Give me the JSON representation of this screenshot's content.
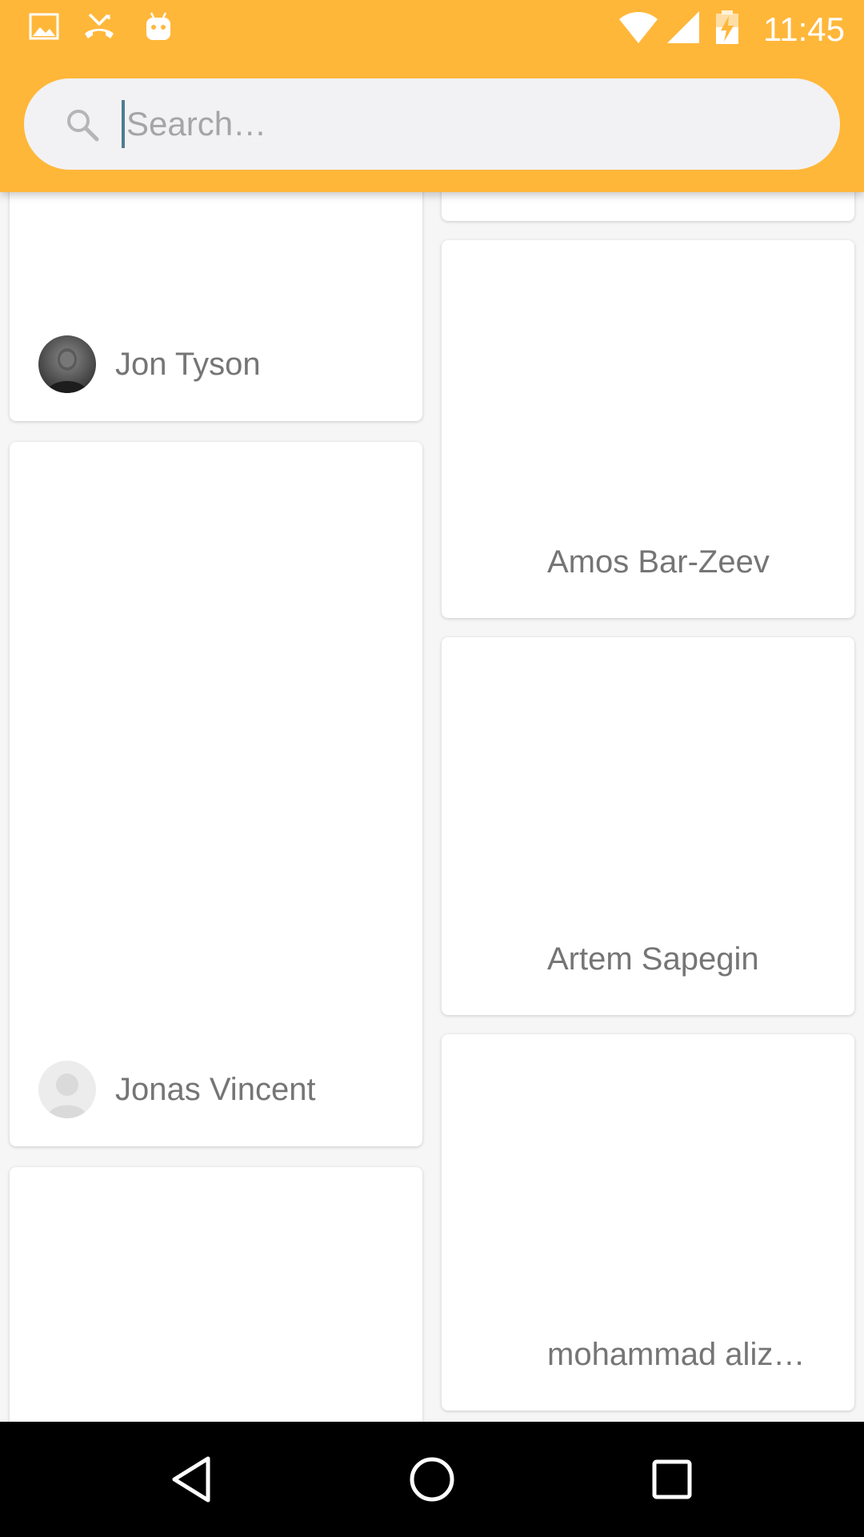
{
  "status_bar": {
    "time": "11:45",
    "left_icons": [
      "image-icon",
      "missed-call-icon",
      "android-icon"
    ],
    "right_icons": [
      "wifi-icon",
      "signal-icon",
      "battery-charging-icon"
    ]
  },
  "search": {
    "placeholder": "Search…",
    "value": ""
  },
  "cards": [
    {
      "name": "Jon Tyson",
      "column": "left",
      "avatar": "photo"
    },
    {
      "name": "Jonas Vincent",
      "column": "left",
      "avatar": "placeholder"
    },
    {
      "name": "",
      "column": "left"
    },
    {
      "name": "",
      "column": "right"
    },
    {
      "name": "Amos Bar-Zeev",
      "column": "right"
    },
    {
      "name": "Artem Sapegin",
      "column": "right"
    },
    {
      "name": "mohammad aliz…",
      "column": "right"
    }
  ],
  "navigation": {
    "buttons": [
      "back",
      "home",
      "recents"
    ]
  },
  "colors": {
    "header": "#FFB73A",
    "search_bg": "#f2f2f4",
    "card_text": "#757575"
  }
}
